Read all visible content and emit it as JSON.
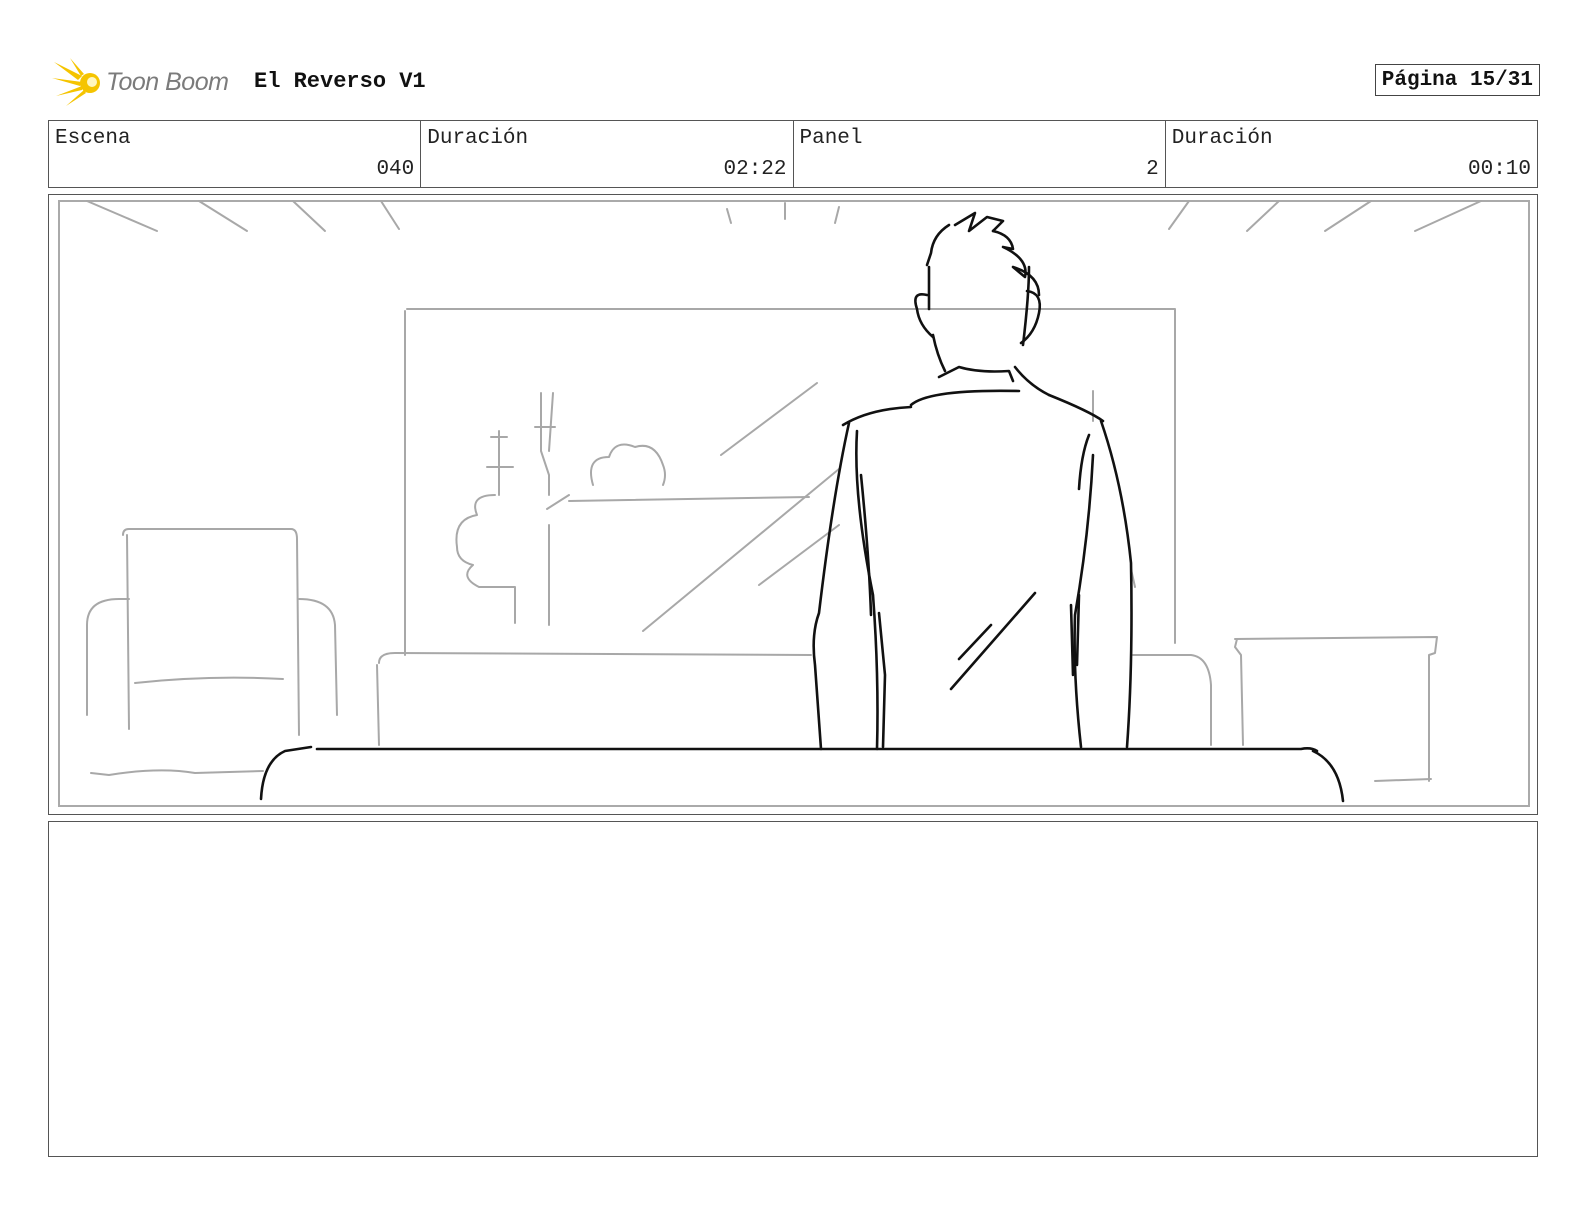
{
  "header": {
    "logo_text": "Toon Boom",
    "project_title": "El Reverso V1",
    "page_label": "Página 15/31"
  },
  "info": [
    {
      "label": "Escena",
      "value": "040"
    },
    {
      "label": "Duración",
      "value": "02:22"
    },
    {
      "label": "Panel",
      "value": "2"
    },
    {
      "label": "Duración",
      "value": "00:10"
    }
  ],
  "colors": {
    "logo_yellow": "#f5c400",
    "logo_text": "#7b7b7b",
    "sketch_dark": "#111111",
    "sketch_light": "#a8a8a8"
  },
  "panel": {
    "description_icon": "storyboard-sketch"
  },
  "notes": {
    "text": ""
  }
}
